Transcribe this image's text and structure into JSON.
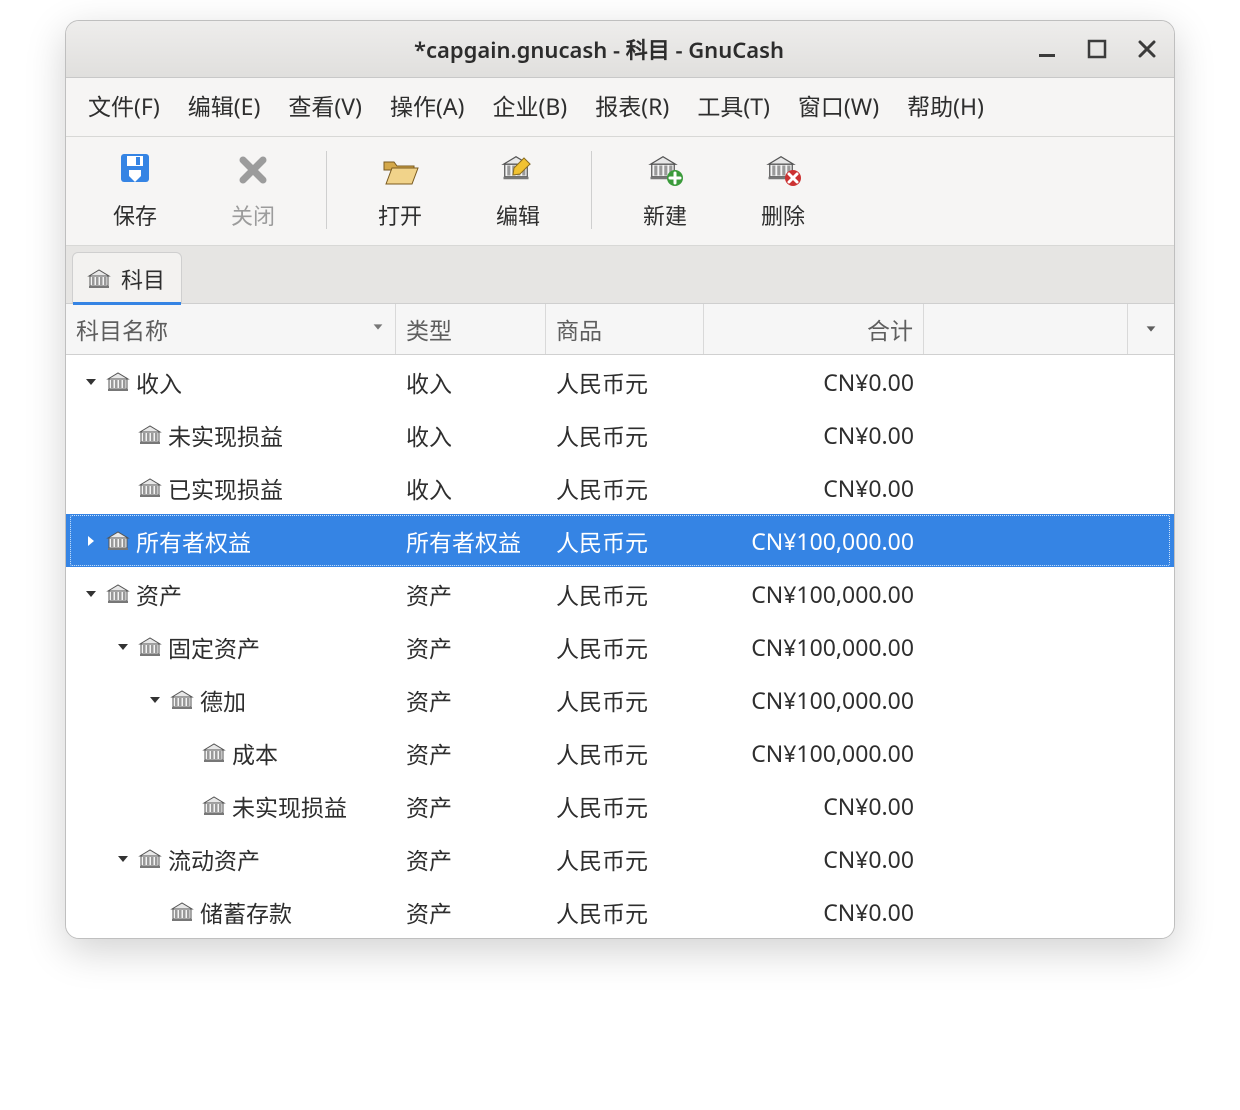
{
  "window": {
    "title": "*capgain.gnucash - 科目 - GnuCash"
  },
  "menubar": {
    "file": "文件(F)",
    "edit": "编辑(E)",
    "view": "查看(V)",
    "actions": "操作(A)",
    "business": "企业(B)",
    "reports": "报表(R)",
    "tools": "工具(T)",
    "windows": "窗口(W)",
    "help": "帮助(H)"
  },
  "toolbar": {
    "save": "保存",
    "close": "关闭",
    "open": "打开",
    "edit": "编辑",
    "new": "新建",
    "delete": "删除"
  },
  "tab": {
    "label": "科目"
  },
  "columns": {
    "name": "科目名称",
    "type": "类型",
    "commodity": "商品",
    "total": "合计"
  },
  "rows": [
    {
      "depth": 0,
      "expand": "down",
      "selected": false,
      "name": "收入",
      "type": "收入",
      "commodity": "人民币元",
      "total": "CN¥0.00"
    },
    {
      "depth": 1,
      "expand": "none",
      "selected": false,
      "name": "未实现损益",
      "type": "收入",
      "commodity": "人民币元",
      "total": "CN¥0.00"
    },
    {
      "depth": 1,
      "expand": "none",
      "selected": false,
      "name": "已实现损益",
      "type": "收入",
      "commodity": "人民币元",
      "total": "CN¥0.00"
    },
    {
      "depth": 0,
      "expand": "right",
      "selected": true,
      "name": "所有者权益",
      "type": "所有者权益",
      "commodity": "人民币元",
      "total": "CN¥100,000.00"
    },
    {
      "depth": 0,
      "expand": "down",
      "selected": false,
      "name": "资产",
      "type": "资产",
      "commodity": "人民币元",
      "total": "CN¥100,000.00"
    },
    {
      "depth": 1,
      "expand": "down",
      "selected": false,
      "name": "固定资产",
      "type": "资产",
      "commodity": "人民币元",
      "total": "CN¥100,000.00"
    },
    {
      "depth": 2,
      "expand": "down",
      "selected": false,
      "name": "德加",
      "type": "资产",
      "commodity": "人民币元",
      "total": "CN¥100,000.00"
    },
    {
      "depth": 3,
      "expand": "none",
      "selected": false,
      "name": "成本",
      "type": "资产",
      "commodity": "人民币元",
      "total": "CN¥100,000.00"
    },
    {
      "depth": 3,
      "expand": "none",
      "selected": false,
      "name": "未实现损益",
      "type": "资产",
      "commodity": "人民币元",
      "total": "CN¥0.00"
    },
    {
      "depth": 1,
      "expand": "down",
      "selected": false,
      "name": "流动资产",
      "type": "资产",
      "commodity": "人民币元",
      "total": "CN¥0.00"
    },
    {
      "depth": 2,
      "expand": "none",
      "selected": false,
      "name": "储蓄存款",
      "type": "资产",
      "commodity": "人民币元",
      "total": "CN¥0.00"
    }
  ]
}
